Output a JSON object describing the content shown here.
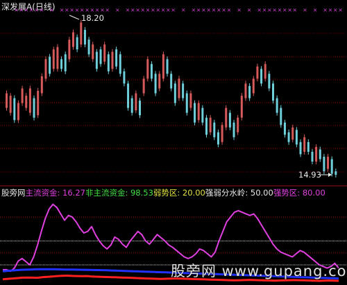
{
  "title": "深发展A(日线)",
  "high_label": "18.20",
  "low_label": "14.93",
  "legend": [
    {
      "text": "股旁网",
      "color": "#e8e8e8"
    },
    {
      "text": "  主流资金: 16.27",
      "color": "#e040e0"
    },
    {
      "text": "  非主流资金: 98.53",
      "color": "#40e040"
    },
    {
      "text": "  弱势区: 20.00",
      "color": "#e0e040"
    },
    {
      "text": "  强弱分水岭: 50.00",
      "color": "#e8e8e8"
    },
    {
      "text": "  强势区: 80.00",
      "color": "#e040e0"
    }
  ],
  "watermark": "股旁网 www.gupang.com",
  "colors": {
    "up": "#d65a5a",
    "down": "#6fd0dc",
    "main_fund": "#e040e0",
    "blue_line": "#2233ff",
    "red_line": "#ff2020",
    "grid_red": "#8b0000",
    "x_marks": "#d040d0"
  },
  "price_range": {
    "min": 14.93,
    "max": 18.2
  },
  "candles": [
    [
      16.3,
      16.6
    ],
    [
      16.2,
      16.55
    ],
    [
      16.5,
      16.05
    ],
    [
      16.05,
      16.4
    ],
    [
      16.4,
      16.7
    ],
    [
      16.3,
      16.55
    ],
    [
      16.2,
      16.7
    ],
    [
      16.5,
      16.1
    ],
    [
      16.15,
      16.65
    ],
    [
      16.6,
      16.95
    ],
    [
      16.9,
      17.3
    ],
    [
      17.35,
      17.0
    ],
    [
      17.1,
      17.5
    ],
    [
      17.1,
      17.55
    ],
    [
      17.3,
      17.1
    ],
    [
      17.4,
      17.05
    ],
    [
      17.3,
      17.7
    ],
    [
      17.55,
      17.85
    ],
    [
      17.75,
      17.5
    ],
    [
      17.6,
      18.05
    ],
    [
      17.9,
      17.6
    ],
    [
      17.7,
      17.4
    ],
    [
      17.3,
      17.6
    ],
    [
      17.45,
      17.1
    ],
    [
      17.5,
      17.2
    ],
    [
      17.25,
      17.6
    ],
    [
      17.4,
      17.05
    ],
    [
      17.1,
      17.45
    ],
    [
      17.5,
      17.15
    ],
    [
      17.4,
      17.0
    ],
    [
      17.05,
      16.8
    ],
    [
      16.8,
      16.3
    ],
    [
      16.5,
      16.2
    ],
    [
      16.25,
      16.6
    ],
    [
      16.45,
      16.15
    ],
    [
      16.6,
      16.9
    ],
    [
      16.9,
      17.3
    ],
    [
      17.2,
      16.9
    ],
    [
      17.0,
      16.6
    ],
    [
      16.7,
      17.0
    ],
    [
      16.9,
      17.4
    ],
    [
      17.3,
      17.0
    ],
    [
      17.0,
      16.7
    ],
    [
      16.8,
      16.4
    ],
    [
      16.5,
      16.9
    ],
    [
      16.8,
      16.5
    ],
    [
      16.6,
      16.2
    ],
    [
      16.3,
      16.6
    ],
    [
      16.4,
      16.0
    ],
    [
      16.05,
      16.4
    ],
    [
      16.3,
      16.0
    ],
    [
      16.1,
      15.75
    ],
    [
      15.8,
      16.1
    ],
    [
      16.0,
      15.7
    ],
    [
      15.8,
      15.55
    ],
    [
      15.6,
      15.95
    ],
    [
      15.9,
      16.3
    ],
    [
      16.2,
      15.9
    ],
    [
      16.0,
      15.7
    ],
    [
      15.8,
      16.1
    ],
    [
      16.1,
      16.55
    ],
    [
      16.5,
      16.8
    ],
    [
      16.75,
      16.5
    ],
    [
      16.6,
      16.9
    ],
    [
      16.9,
      17.15
    ],
    [
      17.1,
      16.8
    ],
    [
      16.9,
      17.2
    ],
    [
      17.0,
      16.7
    ],
    [
      16.8,
      16.45
    ],
    [
      16.5,
      16.2
    ],
    [
      16.3,
      15.95
    ],
    [
      16.0,
      15.75
    ],
    [
      15.8,
      15.6
    ],
    [
      15.65,
      15.9
    ],
    [
      15.85,
      15.55
    ],
    [
      15.6,
      15.35
    ],
    [
      15.4,
      15.7
    ],
    [
      15.6,
      15.4
    ],
    [
      15.4,
      15.2
    ],
    [
      15.2,
      15.5
    ],
    [
      15.45,
      15.25
    ],
    [
      15.3,
      15.0
    ],
    [
      15.05,
      15.3
    ],
    [
      15.25,
      14.95
    ],
    [
      15.0,
      14.93
    ]
  ],
  "main_fund": [
    14,
    14,
    12,
    16,
    25,
    28,
    24,
    20,
    30,
    45,
    62,
    78,
    90,
    96,
    92,
    84,
    76,
    82,
    80,
    74,
    66,
    60,
    62,
    68,
    58,
    50,
    44,
    40,
    45,
    55,
    52,
    46,
    42,
    50,
    56,
    62,
    58,
    50,
    46,
    52,
    58,
    54,
    50,
    45,
    42,
    38,
    34,
    30,
    28,
    30,
    34,
    40,
    38,
    34,
    30,
    36,
    50,
    62,
    74,
    80,
    86,
    88,
    86,
    84,
    82,
    84,
    78,
    70,
    62,
    54,
    46,
    40,
    36,
    34,
    32,
    30,
    34,
    38,
    36,
    32,
    28,
    24,
    20,
    18,
    16,
    18,
    22,
    16
  ],
  "blue_line": [
    12,
    12.5,
    13,
    13.4,
    13.8,
    14,
    14.2,
    14.4,
    14.5,
    14.6,
    14.6,
    14.5,
    14.4,
    14.3,
    14.2,
    14.1,
    14,
    13.9,
    13.8,
    13.7,
    13.6,
    13.5,
    13.4,
    13.2,
    13,
    12.8,
    12.6,
    12.4,
    12.2,
    12,
    11.8,
    11.6,
    11.4,
    11.2,
    11,
    10.8,
    10.6,
    10.4,
    10.2,
    10,
    9.8,
    9.6,
    9.4,
    9.2,
    9,
    8.8,
    8.6,
    8.4,
    8.2,
    8,
    7.8,
    7.6,
    7.4,
    7.2,
    7,
    6.8,
    6.6,
    6.4,
    6.2,
    6,
    5.8,
    5.6,
    5.4,
    5.2,
    5,
    4.8,
    4.6,
    4.4,
    4.2,
    4,
    3.8,
    3.6,
    3.4,
    3.2,
    3
  ],
  "red_line": [
    2,
    2.5,
    3,
    3.5,
    4,
    4.2,
    4,
    3.8,
    4.5,
    5,
    5.5,
    6,
    6.3,
    6.5,
    6.2,
    6,
    5.8,
    6,
    5.5,
    5.2,
    5,
    4.8,
    4.6,
    4.4,
    4.2,
    4,
    3.8,
    3.5,
    3.2,
    3,
    2.8,
    2.6,
    2.4,
    2.6,
    2.8,
    3,
    2.8,
    2.6,
    2.4,
    2.2,
    2,
    1.8,
    1.6,
    1.4,
    1.2,
    1,
    0.8,
    0.6,
    0.8,
    1,
    1.2,
    1,
    0.8,
    0.6,
    0.4,
    0.2,
    0.4,
    0.6,
    0.8,
    1,
    0.8,
    0.6,
    0.4,
    0.2,
    0,
    0.2,
    0.4,
    0.2,
    0
  ],
  "levels": [
    20,
    50,
    80
  ]
}
